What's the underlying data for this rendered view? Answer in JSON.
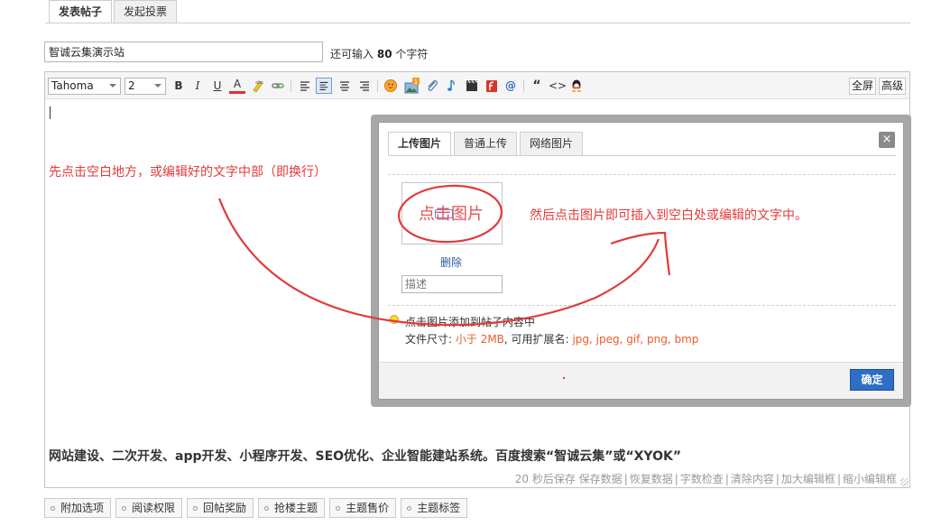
{
  "tabs": [
    "发表帖子",
    "发起投票"
  ],
  "subject": {
    "value": "智诚云集演示站",
    "hint_prefix": "还可输入",
    "remaining": "80",
    "hint_suffix": "个字符"
  },
  "toolbar": {
    "font": "Tahoma",
    "size": "2",
    "bold": "B",
    "italic": "I",
    "underline": "U",
    "fontcolor": "A",
    "quote": "“",
    "code": "<>",
    "fullscreen": "全屏",
    "advanced": "高级"
  },
  "editor": {
    "footer_text": "网站建设、二次开发、app开发、小程序开发、SEO优化、企业智能建站系统。百度搜索“智诚云集”或“XYOK”",
    "status": [
      "20 秒后保存 保存数据",
      "恢复数据",
      "字数检查",
      "清除内容",
      "加大编辑框",
      "缩小编辑框"
    ]
  },
  "dialog": {
    "tabs": [
      "上传图片",
      "普通上传",
      "网络图片"
    ],
    "close": "×",
    "thumb_text": "点击图片",
    "delete": "删除",
    "desc_placeholder": "描述",
    "tip": "点击图片添加到帖子内容中",
    "filesize_label": "文件尺寸:",
    "filesize_value": "小于 2MB",
    "ext_label": ", 可用扩展名:",
    "ext_value": "jpg, jpeg, gif, png, bmp",
    "ok": "确定"
  },
  "annotations": {
    "left": "先点击空白地方，或编辑好的文字中部（即换行）",
    "right": "然后点击图片即可插入到空白处或编辑的文字中。"
  },
  "options": [
    "附加选项",
    "阅读权限",
    "回帖奖励",
    "抢楼主题",
    "主题售价",
    "主题标签"
  ],
  "colors": {
    "annotation": "#e23a3a",
    "primary_button": "#2d6ec6",
    "link": "#2b5c9c",
    "accent": "#ee5a2a"
  }
}
